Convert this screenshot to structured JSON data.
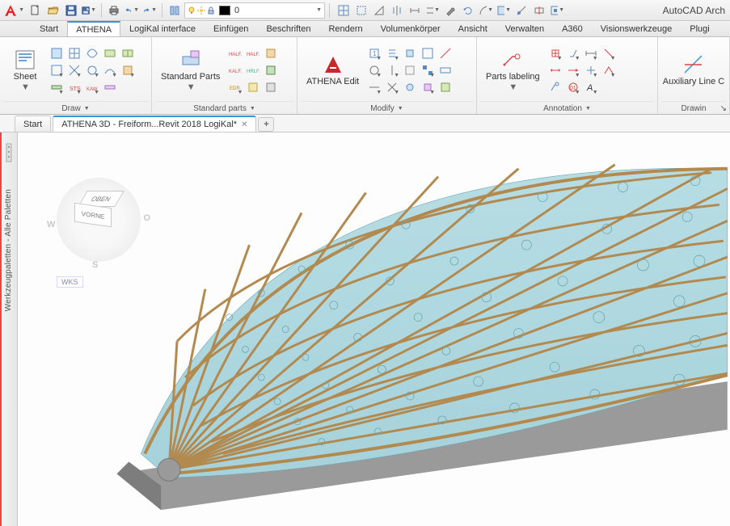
{
  "app": {
    "title": "AutoCAD Arch"
  },
  "qat_layer_label": "0",
  "menus": {
    "items": [
      "Start",
      "ATHENA",
      "LogiKal interface",
      "Einfügen",
      "Beschriften",
      "Rendern",
      "Volumenkörper",
      "Ansicht",
      "Verwalten",
      "A360",
      "Visionswerkzeuge",
      "Plugi"
    ],
    "active_index": 1
  },
  "ribbon": {
    "panels": [
      {
        "name": "Draw",
        "big": {
          "label": "Sheet",
          "icon": "sheet"
        }
      },
      {
        "name": "Standard parts",
        "big": {
          "label": "Standard Parts",
          "icon": "stdparts"
        }
      },
      {
        "name": "Modify",
        "big": {
          "label": "ATHENA Edit",
          "icon": "athedit"
        }
      },
      {
        "name": "Annotation",
        "big": {
          "label": "Parts labeling",
          "icon": "partslabel"
        }
      },
      {
        "name": "Drawin",
        "big": {
          "label": "Auxiliary Line C",
          "icon": "auxline"
        }
      }
    ]
  },
  "filetabs": {
    "tabs": [
      {
        "label": "Start",
        "active": false,
        "dirty": false
      },
      {
        "label": "ATHENA 3D - Freiform...Revit 2018 LogiKal*",
        "active": true,
        "dirty": true
      }
    ]
  },
  "palette": {
    "title": "Werkzeugpaletten - Alle Paletten"
  },
  "viewcube": {
    "top": "OBEN",
    "front": "VORNE",
    "w": "W",
    "o": "O",
    "s": "S",
    "wks": "WKS"
  },
  "icons": {
    "bulb": "bulb",
    "sun": "sun",
    "lock": "lock",
    "swatch": "swatch"
  }
}
